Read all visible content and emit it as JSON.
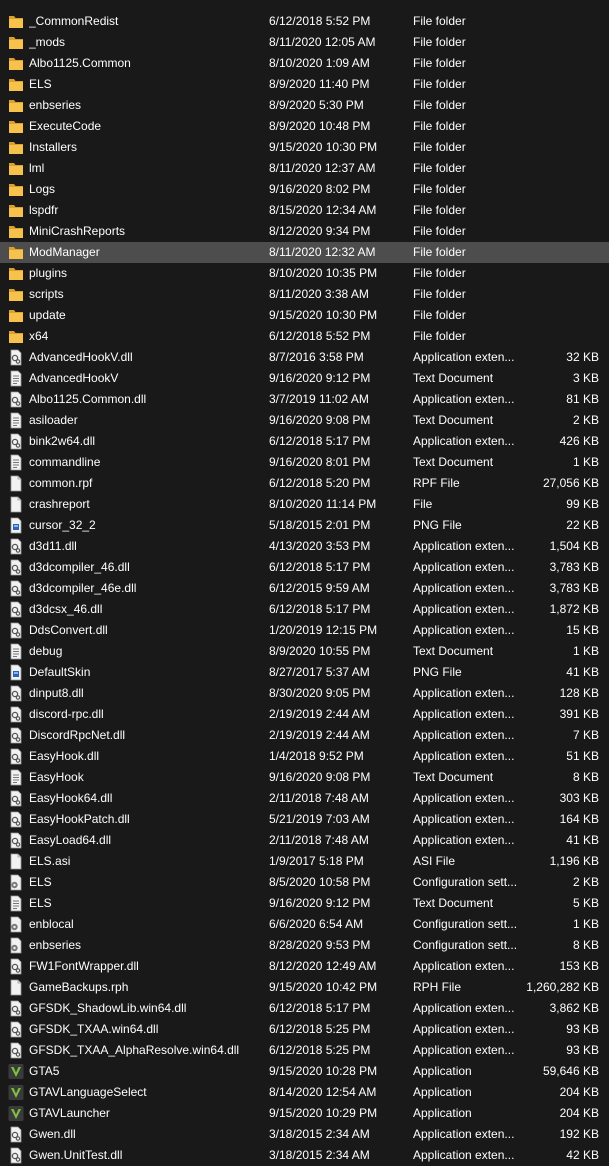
{
  "colors": {
    "background": "#191919",
    "text": "#ffffff",
    "selected_row": "#4d4d4d",
    "folder": "#f7c24b"
  },
  "files": [
    {
      "name": "_CommonRedist",
      "date": "6/12/2018 5:52 PM",
      "type": "File folder",
      "size": "",
      "icon": "folder-icon"
    },
    {
      "name": "_mods",
      "date": "8/11/2020 12:05 AM",
      "type": "File folder",
      "size": "",
      "icon": "folder-icon"
    },
    {
      "name": "Albo1125.Common",
      "date": "8/10/2020 1:09 AM",
      "type": "File folder",
      "size": "",
      "icon": "folder-icon"
    },
    {
      "name": "ELS",
      "date": "8/9/2020 11:40 PM",
      "type": "File folder",
      "size": "",
      "icon": "folder-icon"
    },
    {
      "name": "enbseries",
      "date": "8/9/2020 5:30 PM",
      "type": "File folder",
      "size": "",
      "icon": "folder-icon"
    },
    {
      "name": "ExecuteCode",
      "date": "8/9/2020 10:48 PM",
      "type": "File folder",
      "size": "",
      "icon": "folder-icon"
    },
    {
      "name": "Installers",
      "date": "9/15/2020 10:30 PM",
      "type": "File folder",
      "size": "",
      "icon": "folder-icon"
    },
    {
      "name": "lml",
      "date": "8/11/2020 12:37 AM",
      "type": "File folder",
      "size": "",
      "icon": "folder-icon"
    },
    {
      "name": "Logs",
      "date": "9/16/2020 8:02 PM",
      "type": "File folder",
      "size": "",
      "icon": "folder-icon"
    },
    {
      "name": "lspdfr",
      "date": "8/15/2020 12:34 AM",
      "type": "File folder",
      "size": "",
      "icon": "folder-icon"
    },
    {
      "name": "MiniCrashReports",
      "date": "8/12/2020 9:34 PM",
      "type": "File folder",
      "size": "",
      "icon": "folder-icon"
    },
    {
      "name": "ModManager",
      "date": "8/11/2020 12:32 AM",
      "type": "File folder",
      "size": "",
      "icon": "folder-icon",
      "selected": true
    },
    {
      "name": "plugins",
      "date": "8/10/2020 10:35 PM",
      "type": "File folder",
      "size": "",
      "icon": "folder-icon"
    },
    {
      "name": "scripts",
      "date": "8/11/2020 3:38 AM",
      "type": "File folder",
      "size": "",
      "icon": "folder-icon"
    },
    {
      "name": "update",
      "date": "9/15/2020 10:30 PM",
      "type": "File folder",
      "size": "",
      "icon": "folder-icon"
    },
    {
      "name": "x64",
      "date": "6/12/2018 5:52 PM",
      "type": "File folder",
      "size": "",
      "icon": "folder-icon"
    },
    {
      "name": "AdvancedHookV.dll",
      "date": "8/7/2016 3:58 PM",
      "type": "Application exten...",
      "size": "32 KB",
      "icon": "dll-icon"
    },
    {
      "name": "AdvancedHookV",
      "date": "9/16/2020 9:12 PM",
      "type": "Text Document",
      "size": "3 KB",
      "icon": "text-document-icon"
    },
    {
      "name": "Albo1125.Common.dll",
      "date": "3/7/2019 11:02 AM",
      "type": "Application exten...",
      "size": "81 KB",
      "icon": "dll-icon"
    },
    {
      "name": "asiloader",
      "date": "9/16/2020 9:08 PM",
      "type": "Text Document",
      "size": "2 KB",
      "icon": "text-document-icon"
    },
    {
      "name": "bink2w64.dll",
      "date": "6/12/2018 5:17 PM",
      "type": "Application exten...",
      "size": "426 KB",
      "icon": "dll-icon"
    },
    {
      "name": "commandline",
      "date": "9/16/2020 8:01 PM",
      "type": "Text Document",
      "size": "1 KB",
      "icon": "text-document-icon"
    },
    {
      "name": "common.rpf",
      "date": "6/12/2018 5:20 PM",
      "type": "RPF File",
      "size": "27,056 KB",
      "icon": "blank-file-icon"
    },
    {
      "name": "crashreport",
      "date": "8/10/2020 11:14 PM",
      "type": "File",
      "size": "99 KB",
      "icon": "blank-file-icon"
    },
    {
      "name": "cursor_32_2",
      "date": "5/18/2015 2:01 PM",
      "type": "PNG File",
      "size": "22 KB",
      "icon": "image-file-icon"
    },
    {
      "name": "d3d11.dll",
      "date": "4/13/2020 3:53 PM",
      "type": "Application exten...",
      "size": "1,504 KB",
      "icon": "dll-icon"
    },
    {
      "name": "d3dcompiler_46.dll",
      "date": "6/12/2018 5:17 PM",
      "type": "Application exten...",
      "size": "3,783 KB",
      "icon": "dll-icon"
    },
    {
      "name": "d3dcompiler_46e.dll",
      "date": "6/12/2015 9:59 AM",
      "type": "Application exten...",
      "size": "3,783 KB",
      "icon": "dll-icon"
    },
    {
      "name": "d3dcsx_46.dll",
      "date": "6/12/2018 5:17 PM",
      "type": "Application exten...",
      "size": "1,872 KB",
      "icon": "dll-icon"
    },
    {
      "name": "DdsConvert.dll",
      "date": "1/20/2019 12:15 PM",
      "type": "Application exten...",
      "size": "15 KB",
      "icon": "dll-icon"
    },
    {
      "name": "debug",
      "date": "8/9/2020 10:55 PM",
      "type": "Text Document",
      "size": "1 KB",
      "icon": "text-document-icon"
    },
    {
      "name": "DefaultSkin",
      "date": "8/27/2017 5:37 AM",
      "type": "PNG File",
      "size": "41 KB",
      "icon": "image-file-icon"
    },
    {
      "name": "dinput8.dll",
      "date": "8/30/2020 9:05 PM",
      "type": "Application exten...",
      "size": "128 KB",
      "icon": "dll-icon"
    },
    {
      "name": "discord-rpc.dll",
      "date": "2/19/2019 2:44 AM",
      "type": "Application exten...",
      "size": "391 KB",
      "icon": "dll-icon"
    },
    {
      "name": "DiscordRpcNet.dll",
      "date": "2/19/2019 2:44 AM",
      "type": "Application exten...",
      "size": "7 KB",
      "icon": "dll-icon"
    },
    {
      "name": "EasyHook.dll",
      "date": "1/4/2018 9:52 PM",
      "type": "Application exten...",
      "size": "51 KB",
      "icon": "dll-icon"
    },
    {
      "name": "EasyHook",
      "date": "9/16/2020 9:08 PM",
      "type": "Text Document",
      "size": "8 KB",
      "icon": "text-document-icon"
    },
    {
      "name": "EasyHook64.dll",
      "date": "2/11/2018 7:48 AM",
      "type": "Application exten...",
      "size": "303 KB",
      "icon": "dll-icon"
    },
    {
      "name": "EasyHookPatch.dll",
      "date": "5/21/2019 7:03 AM",
      "type": "Application exten...",
      "size": "164 KB",
      "icon": "dll-icon"
    },
    {
      "name": "EasyLoad64.dll",
      "date": "2/11/2018 7:48 AM",
      "type": "Application exten...",
      "size": "41 KB",
      "icon": "dll-icon"
    },
    {
      "name": "ELS.asi",
      "date": "1/9/2017 5:18 PM",
      "type": "ASI File",
      "size": "1,196 KB",
      "icon": "blank-file-icon"
    },
    {
      "name": "ELS",
      "date": "8/5/2020 10:58 PM",
      "type": "Configuration sett...",
      "size": "2 KB",
      "icon": "config-file-icon"
    },
    {
      "name": "ELS",
      "date": "9/16/2020 9:12 PM",
      "type": "Text Document",
      "size": "5 KB",
      "icon": "text-document-icon"
    },
    {
      "name": "enblocal",
      "date": "6/6/2020 6:54 AM",
      "type": "Configuration sett...",
      "size": "1 KB",
      "icon": "config-file-icon"
    },
    {
      "name": "enbseries",
      "date": "8/28/2020 9:53 PM",
      "type": "Configuration sett...",
      "size": "8 KB",
      "icon": "config-file-icon"
    },
    {
      "name": "FW1FontWrapper.dll",
      "date": "8/12/2020 12:49 AM",
      "type": "Application exten...",
      "size": "153 KB",
      "icon": "dll-icon"
    },
    {
      "name": "GameBackups.rph",
      "date": "9/15/2020 10:42 PM",
      "type": "RPH File",
      "size": "1,260,282 KB",
      "icon": "blank-file-icon"
    },
    {
      "name": "GFSDK_ShadowLib.win64.dll",
      "date": "6/12/2018 5:17 PM",
      "type": "Application exten...",
      "size": "3,862 KB",
      "icon": "dll-icon"
    },
    {
      "name": "GFSDK_TXAA.win64.dll",
      "date": "6/12/2018 5:25 PM",
      "type": "Application exten...",
      "size": "93 KB",
      "icon": "dll-icon"
    },
    {
      "name": "GFSDK_TXAA_AlphaResolve.win64.dll",
      "date": "6/12/2018 5:25 PM",
      "type": "Application exten...",
      "size": "93 KB",
      "icon": "dll-icon"
    },
    {
      "name": "GTA5",
      "date": "9/15/2020 10:28 PM",
      "type": "Application",
      "size": "59,646 KB",
      "icon": "gta-v-app-icon"
    },
    {
      "name": "GTAVLanguageSelect",
      "date": "8/14/2020 12:54 AM",
      "type": "Application",
      "size": "204 KB",
      "icon": "gta-v-app-icon"
    },
    {
      "name": "GTAVLauncher",
      "date": "9/15/2020 10:29 PM",
      "type": "Application",
      "size": "204 KB",
      "icon": "gta-v-app-icon"
    },
    {
      "name": "Gwen.dll",
      "date": "3/18/2015 2:34 AM",
      "type": "Application exten...",
      "size": "192 KB",
      "icon": "dll-icon"
    },
    {
      "name": "Gwen.UnitTest.dll",
      "date": "3/18/2015 2:34 AM",
      "type": "Application exten...",
      "size": "42 KB",
      "icon": "dll-icon"
    }
  ]
}
